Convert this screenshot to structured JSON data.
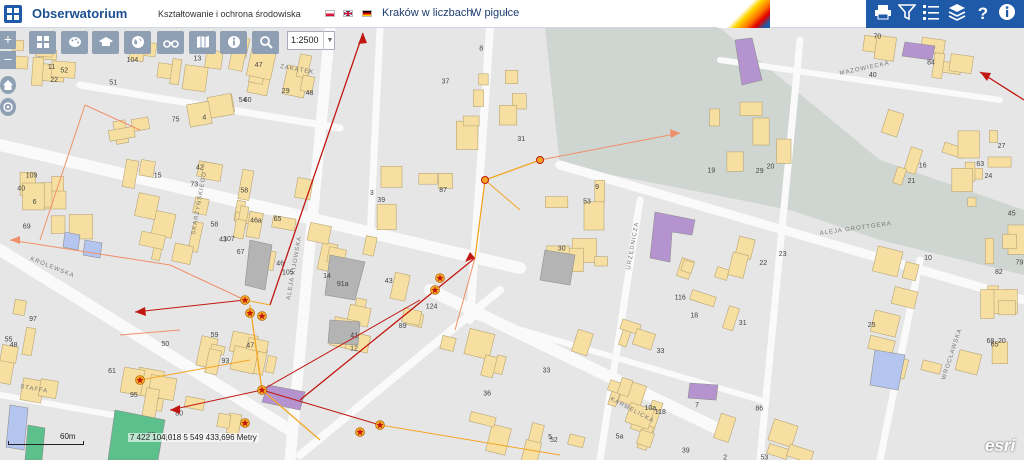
{
  "app": {
    "title": "Obserwatorium",
    "section": "Kształtowanie i ochrona środowiska",
    "link_numbers": "Kraków w liczbach",
    "link_nutshell": "W pigułce"
  },
  "languages": [
    {
      "name": "flag-pl-icon",
      "colors": [
        "#ffffff",
        "#dc143c"
      ]
    },
    {
      "name": "flag-en-icon",
      "colors": [
        "#012169",
        "#c8102e"
      ]
    },
    {
      "name": "flag-de-icon",
      "colors": [
        "#000000",
        "#dd0000",
        "#ffce00"
      ]
    }
  ],
  "header_tools": [
    "print-icon",
    "filter-icon",
    "list-icon",
    "layers-icon",
    "help-icon",
    "info-icon"
  ],
  "map_tools": [
    "grid-icon",
    "palette-icon",
    "education-icon",
    "globe-icon",
    "binoculars-icon",
    "map-icon",
    "info-icon",
    "search-icon"
  ],
  "scale": {
    "value": "1:2500"
  },
  "coords": "7 422 104,018 5 549 433,696 Metry",
  "scalebar": {
    "label": "60m"
  },
  "attribution": "esri",
  "colors": {
    "brand": "#1f5aa8",
    "building": "#f6dfa0",
    "building_outline": "#b9a577",
    "park": "#c9d0cb",
    "road": "#ffffff",
    "route_dark": "#c01810",
    "route_light": "#f0906a",
    "route_orange": "#f4a524",
    "purple": "#b593cf",
    "gray_building": "#b4b4b4",
    "blue_building": "#b4c6f0",
    "green_building": "#5cc08c"
  },
  "map_labels": {
    "streets": [
      "KRÓLEWSKA",
      "ALEJA KIJOWSKA",
      "ALEJA GROTTGERA",
      "URZĘDNICZA",
      "KARMELICKA",
      "WROCŁAWSKA",
      "STAFFA",
      "MAZOWIECKA",
      "ZAKĄTEK",
      "SKARŻYŃSKIEGO"
    ],
    "house_numbers": [
      "4",
      "15",
      "109",
      "107",
      "105",
      "97",
      "95",
      "93",
      "91a",
      "89",
      "87",
      "8",
      "124",
      "118",
      "116",
      "20",
      "16",
      "10",
      "65",
      "63",
      "48",
      "104",
      "22",
      "30",
      "39",
      "52",
      "53",
      "40",
      "79",
      "77",
      "75",
      "73",
      "69",
      "67",
      "65",
      "55",
      "61",
      "59",
      "14",
      "12",
      "3",
      "31",
      "33",
      "10a",
      "18",
      "19",
      "21",
      "23",
      "25",
      "27",
      "29",
      "13",
      "11",
      "9",
      "7",
      "5",
      "2",
      "70",
      "68",
      "44",
      "54",
      "42",
      "40",
      "43",
      "46",
      "48",
      "50",
      "47",
      "43",
      "41",
      "39",
      "37",
      "36",
      "33",
      "31",
      "29",
      "24",
      "22",
      "20",
      "45",
      "47",
      "51",
      "52",
      "53",
      "5a",
      "3",
      "86",
      "84",
      "82",
      "80",
      "60",
      "58",
      "6",
      "58",
      "46a"
    ]
  }
}
